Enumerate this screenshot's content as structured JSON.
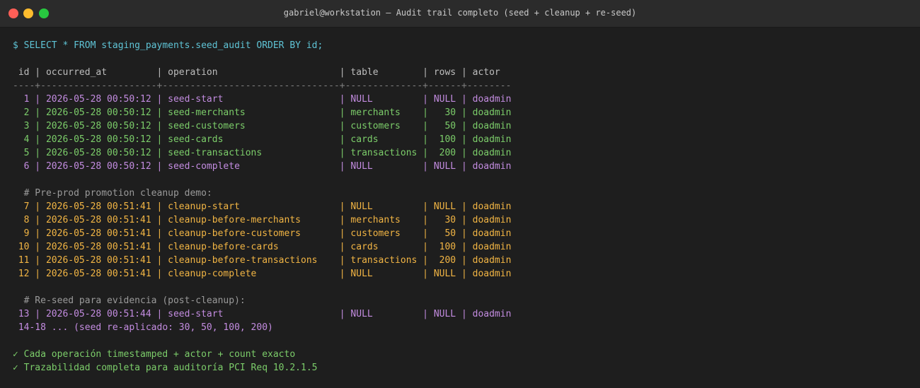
{
  "window": {
    "title": "gabriel@workstation — Audit trail completo (seed + cleanup + re-seed)"
  },
  "terminal": {
    "command": "$ SELECT * FROM staging_payments.seed_audit ORDER BY id;",
    "header": " id | occurred_at         | operation                      | table        | rows | actor",
    "separator": "----+---------------------+--------------------------------+--------------+------+--------",
    "seed_rows": [
      "  1 | 2026-05-28 00:50:12 | seed-start                     | NULL         | NULL | doadmin",
      "  2 | 2026-05-28 00:50:12 | seed-merchants                 | merchants    |   30 | doadmin",
      "  3 | 2026-05-28 00:50:12 | seed-customers                 | customers    |   50 | doadmin",
      "  4 | 2026-05-28 00:50:12 | seed-cards                     | cards        |  100 | doadmin",
      "  5 | 2026-05-28 00:50:12 | seed-transactions              | transactions |  200 | doadmin",
      "  6 | 2026-05-28 00:50:12 | seed-complete                  | NULL         | NULL | doadmin"
    ],
    "cleanup_comment": "  # Pre-prod promotion cleanup demo:",
    "cleanup_rows": [
      "  7 | 2026-05-28 00:51:41 | cleanup-start                  | NULL         | NULL | doadmin",
      "  8 | 2026-05-28 00:51:41 | cleanup-before-merchants       | merchants    |   30 | doadmin",
      "  9 | 2026-05-28 00:51:41 | cleanup-before-customers       | customers    |   50 | doadmin",
      " 10 | 2026-05-28 00:51:41 | cleanup-before-cards           | cards        |  100 | doadmin",
      " 11 | 2026-05-28 00:51:41 | cleanup-before-transactions    | transactions |  200 | doadmin",
      " 12 | 2026-05-28 00:51:41 | cleanup-complete               | NULL         | NULL | doadmin"
    ],
    "reseed_comment": "  # Re-seed para evidencia (post-cleanup):",
    "reseed_row": " 13 | 2026-05-28 00:51:44 | seed-start                     | NULL         | NULL | doadmin",
    "reseed_summary": " 14-18 ... (seed re-aplicado: 30, 50, 100, 200)",
    "checks": [
      "✓ Cada operación timestamped + actor + count exacto",
      "✓ Trazabilidad completa para auditoría PCI Req 10.2.1.5"
    ]
  },
  "colors": {
    "command": "#5fc4d6",
    "seed_start_end": "#c38ce0",
    "seed_data": "#7ccd6a",
    "cleanup": "#f2b544",
    "comment": "#9a9a9a",
    "check": "#7ccd6a"
  }
}
